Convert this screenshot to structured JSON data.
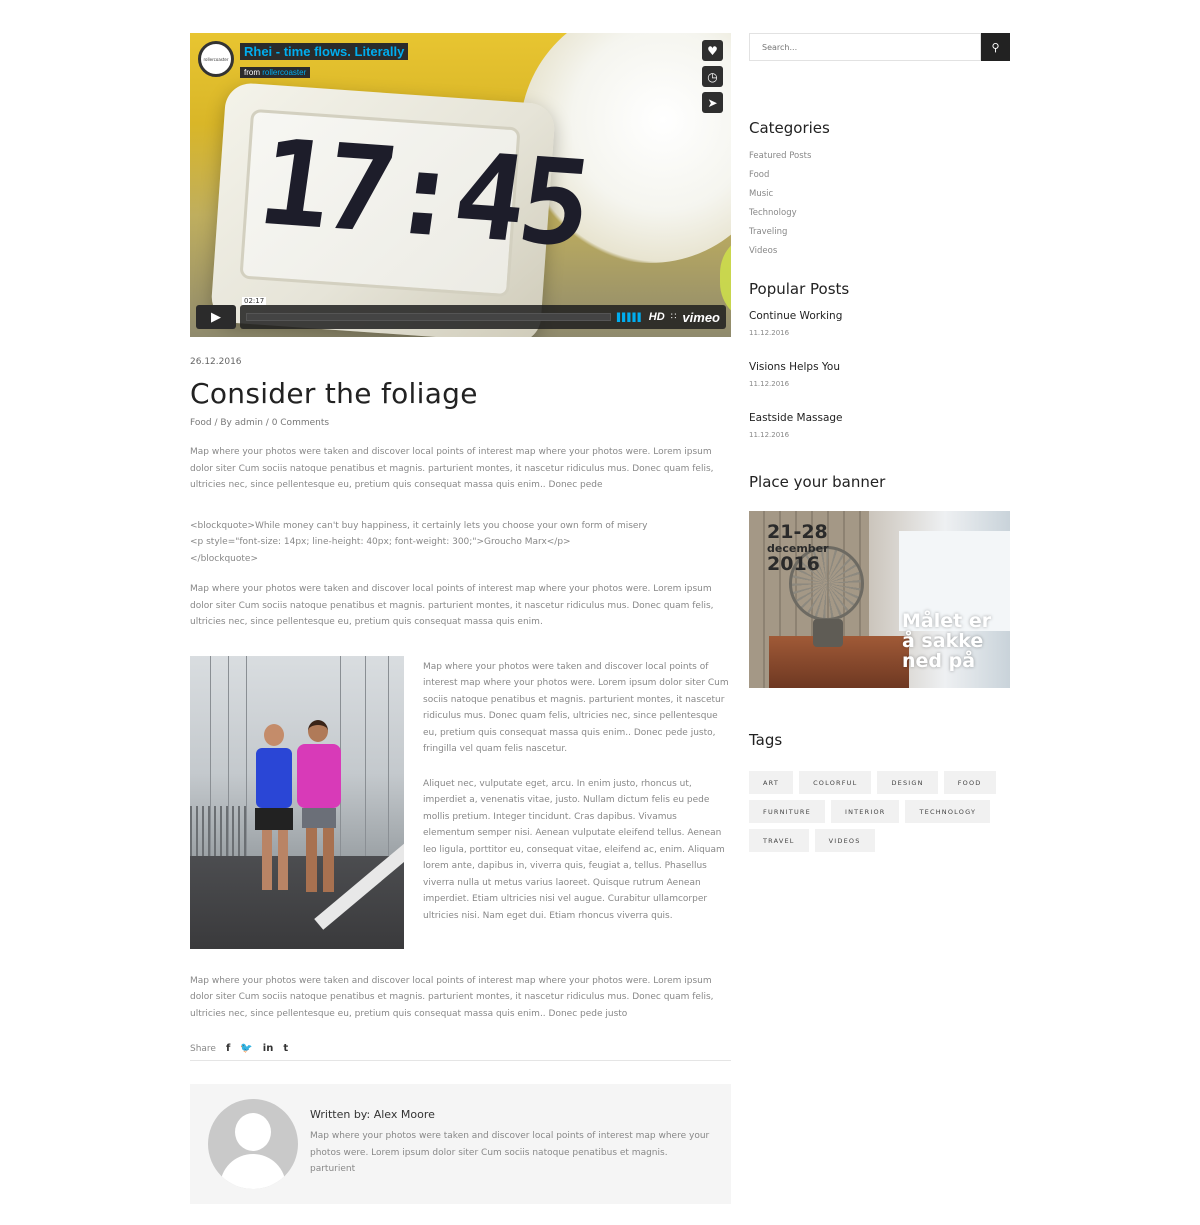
{
  "video": {
    "title": "Rhei - time flows. Literally",
    "from_label": "from",
    "from_user": "rollercoaster",
    "logo_text": "rollercoaster",
    "clock_digits": "17:45",
    "time": "02:17",
    "hd": "HD",
    "brand": "vimeo",
    "icons": [
      "heart-icon",
      "clock-icon",
      "send-icon",
      "play-icon",
      "volume-icon",
      "fullscreen-icon"
    ]
  },
  "post": {
    "date": "26.12.2016",
    "title": "Consider the foliage",
    "meta": {
      "category": "Food",
      "sep1": " / ",
      "author": "By admin",
      "sep2": " / ",
      "comments": "0 Comments"
    },
    "paragraph1": "Map where your photos were taken and discover local points of interest map where your photos were. Lorem ipsum dolor siter Cum sociis natoque penatibus et magnis. parturient montes, it nascetur ridiculus mus. Donec quam felis, ultricies nec, since pellentesque eu, pretium quis consequat massa quis enim.. Donec pede",
    "quote": {
      "line1": "<blockquote>While money can't buy happiness, it certainly lets you choose your own form of misery",
      "line2": "<p style=\"font-size: 14px; line-height: 40px; font-weight: 300;\">Groucho Marx</p>",
      "line3": "</blockquote>"
    },
    "paragraph2": "Map where your photos were taken and discover local points of interest map where your photos were. Lorem ipsum dolor siter Cum sociis natoque penatibus et magnis. parturient montes, it nascetur ridiculus mus. Donec quam felis, ultricies nec, since pellentesque eu, pretium quis consequat massa quis enim.",
    "side_paragraph1": "Map where your photos were taken and discover local points of interest map where your photos were. Lorem ipsum dolor siter Cum sociis natoque penatibus et magnis. parturient montes, it nascetur ridiculus mus. Donec quam felis, ultricies nec, since pellentesque eu, pretium quis consequat  massa quis enim.. Donec pede justo, fringilla vel quam felis nascetur.",
    "side_paragraph2": "Aliquet nec, vulputate eget, arcu. In enim justo, rhoncus ut, imperdiet a, venenatis vitae, justo. Nullam dictum felis eu pede mollis pretium. Integer tincidunt. Cras dapibus. Vivamus elementum semper nisi. Aenean vulputate eleifend tellus. Aenean leo ligula, porttitor eu, consequat vitae, eleifend ac, enim. Aliquam lorem ante, dapibus in, viverra quis, feugiat a, tellus. Phasellus viverra nulla ut metus varius laoreet. Quisque rutrum Aenean imperdiet. Etiam ultricies nisi vel augue. Curabitur ullamcorper ultricies nisi. Nam eget dui. Etiam rhoncus viverra quis.",
    "paragraph3": "Map where your photos were taken and discover local points of interest map where your photos were. Lorem ipsum dolor siter Cum sociis natoque penatibus et magnis. parturient montes, it nascetur ridiculus mus. Donec quam felis, ultricies nec, since pellentesque eu, pretium quis consequat massa quis enim.. Donec pede justo",
    "share": {
      "label": "Share",
      "facebook": "f",
      "twitter": "❀",
      "linkedin": "in",
      "tumblr": "t"
    }
  },
  "author": {
    "name": "Written by: Alex Moore",
    "bio": "Map where your photos were taken and discover local points of interest map where your photos were. Lorem ipsum dolor siter Cum sociis natoque penatibus et magnis. parturient"
  },
  "sidebar": {
    "search_placeholder": "Search...",
    "categories_title": "Categories",
    "categories": [
      "Featured Posts",
      "Food",
      "Music",
      "Technology",
      "Traveling",
      "Videos"
    ],
    "popular_title": "Popular Posts",
    "popular": [
      {
        "title": "Continue Working",
        "date": "11.12.2016"
      },
      {
        "title": "Visions Helps You",
        "date": "11.12.2016"
      },
      {
        "title": "Eastside Massage",
        "date": "11.12.2016"
      }
    ],
    "banner_title": "Place your banner",
    "banner": {
      "dates": "21-28",
      "month": "december",
      "year": "2016",
      "slogan1": "Målet er",
      "slogan2": "å sakke",
      "slogan3": "ned på"
    },
    "tags_title": "Tags",
    "tags": [
      "ART",
      "COLORFUL",
      "DESIGN",
      "FOOD",
      "FURNITURE",
      "INTERIOR",
      "TECHNOLOGY",
      "TRAVEL",
      "VIDEOS"
    ]
  }
}
